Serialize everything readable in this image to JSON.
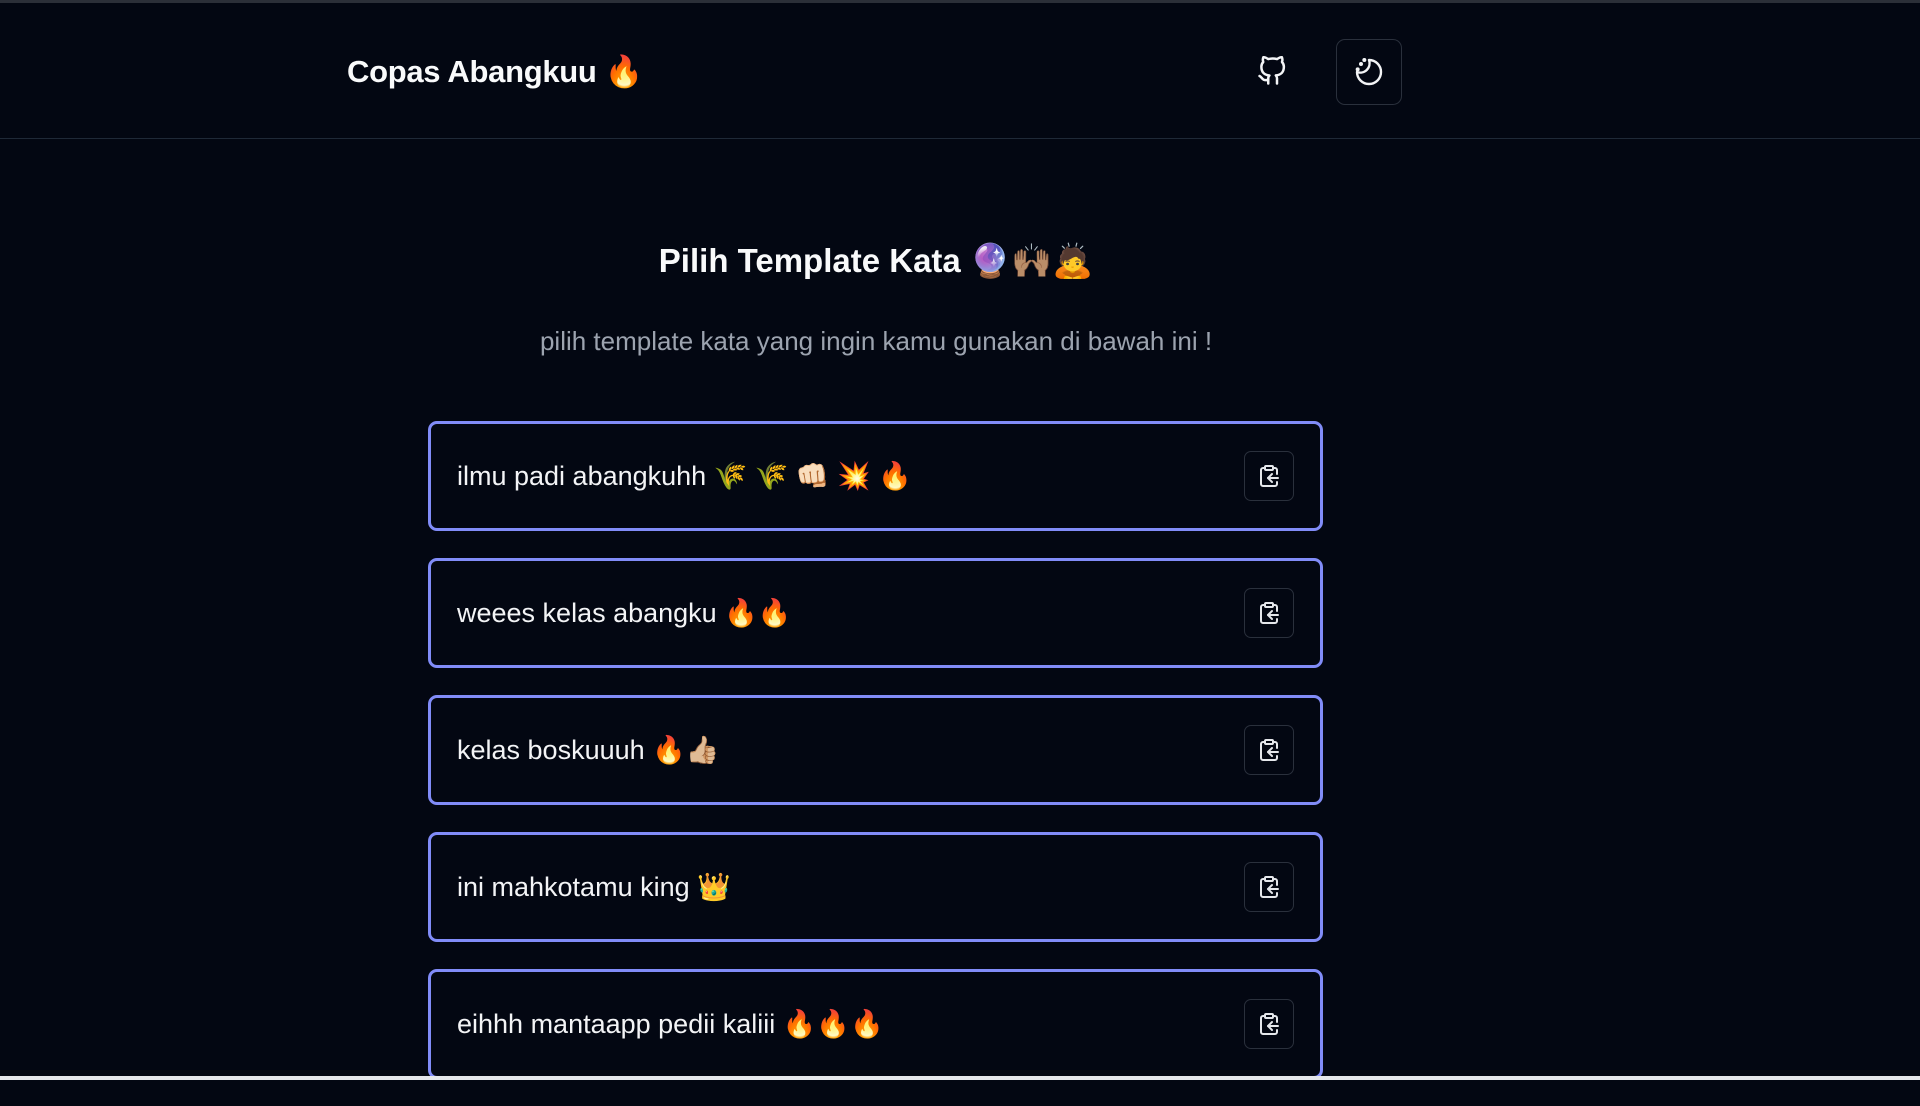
{
  "header": {
    "brand": "Copas Abangkuu 🔥",
    "github_icon": "github-icon",
    "theme_icon": "moon-stars-icon"
  },
  "main": {
    "title": "Pilih Template Kata 🔮🙌🏽🙇",
    "subtitle": "pilih template kata yang ingin kamu gunakan di bawah ini !"
  },
  "templates": [
    {
      "text": "ilmu padi abangkuhh 🌾 🌾 👊🏻 💥 🔥",
      "icon": "clipboard-copy-icon"
    },
    {
      "text": "weees kelas abangku 🔥🔥",
      "icon": "clipboard-copy-icon"
    },
    {
      "text": "kelas boskuuuh 🔥👍🏼",
      "icon": "clipboard-copy-icon"
    },
    {
      "text": "ini mahkotamu king 👑",
      "icon": "clipboard-copy-icon"
    },
    {
      "text": "eihhh mantaapp pedii kaliii 🔥🔥🔥",
      "icon": "clipboard-copy-icon"
    }
  ],
  "colors": {
    "background": "#030712",
    "card_border": "#818cf8",
    "subtitle": "#9ca3af"
  }
}
